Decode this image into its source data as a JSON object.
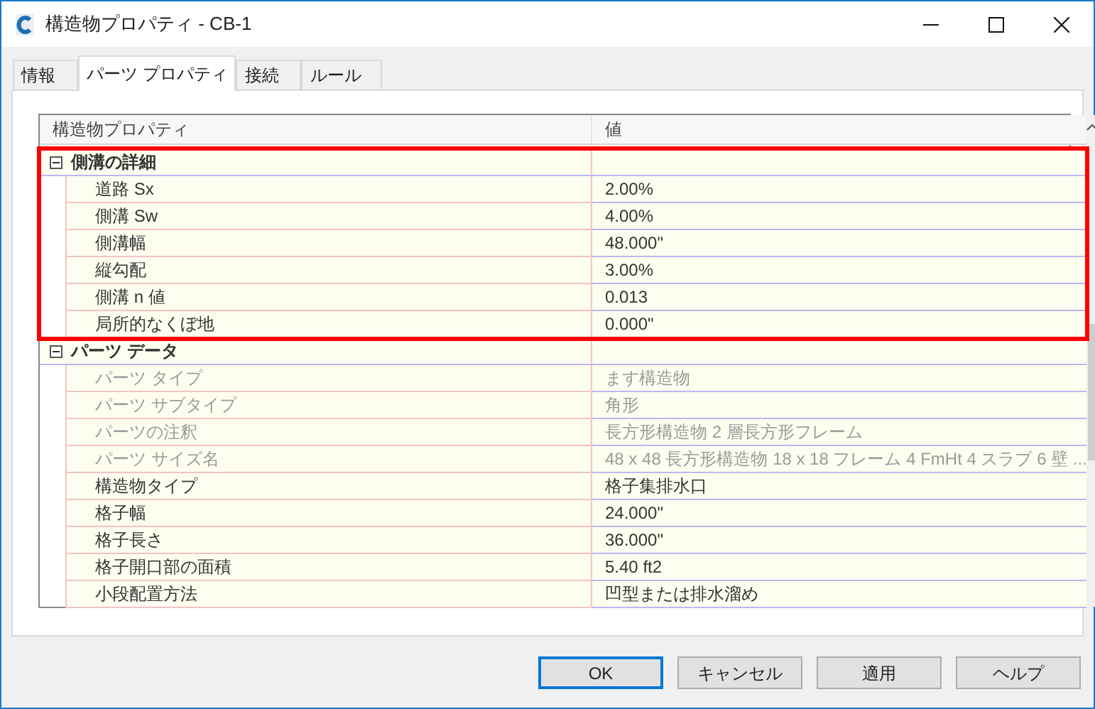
{
  "window": {
    "title": "構造物プロパティ - CB-1"
  },
  "tabs": [
    {
      "label": "情報",
      "selected": false
    },
    {
      "label": "パーツ プロパティ",
      "selected": true
    },
    {
      "label": "接続",
      "selected": false
    },
    {
      "label": "ルール",
      "selected": false
    }
  ],
  "grid": {
    "columns": [
      "構造物プロパティ",
      "値"
    ],
    "groups": [
      {
        "label": "側溝の詳細",
        "expanded": true,
        "highlighted": true,
        "rows": [
          {
            "name": "道路 Sx",
            "value": "2.00%",
            "disabled": false
          },
          {
            "name": "側溝 Sw",
            "value": "4.00%",
            "disabled": false
          },
          {
            "name": "側溝幅",
            "value": "48.000\"",
            "disabled": false
          },
          {
            "name": "縦勾配",
            "value": "3.00%",
            "disabled": false
          },
          {
            "name": "側溝 n 値",
            "value": "0.013",
            "disabled": false
          },
          {
            "name": "局所的なくぼ地",
            "value": "0.000\"",
            "disabled": false
          }
        ]
      },
      {
        "label": "パーツ データ",
        "expanded": true,
        "highlighted": false,
        "rows": [
          {
            "name": "パーツ タイプ",
            "value": "ます構造物",
            "disabled": true
          },
          {
            "name": "パーツ サブタイプ",
            "value": "角形",
            "disabled": true
          },
          {
            "name": "パーツの注釈",
            "value": "長方形構造物 2 層長方形フレーム",
            "disabled": true
          },
          {
            "name": "パーツ サイズ名",
            "value": "48 x 48 長方形構造物 18 x 18 フレーム 4 FmHt 4 スラブ 6 壁 ...",
            "disabled": true
          },
          {
            "name": "構造物タイプ",
            "value": "格子集排水口",
            "disabled": false
          },
          {
            "name": "格子幅",
            "value": "24.000\"",
            "disabled": false
          },
          {
            "name": "格子長さ",
            "value": "36.000\"",
            "disabled": false
          },
          {
            "name": "格子開口部の面積",
            "value": "5.40 ft2",
            "disabled": false
          },
          {
            "name": "小段配置方法",
            "value": "凹型または排水溜め",
            "disabled": false
          }
        ]
      }
    ]
  },
  "buttons": [
    {
      "label": "OK",
      "default": true
    },
    {
      "label": "キャンセル",
      "default": false
    },
    {
      "label": "適用",
      "default": false
    },
    {
      "label": "ヘルプ",
      "default": false
    }
  ]
}
